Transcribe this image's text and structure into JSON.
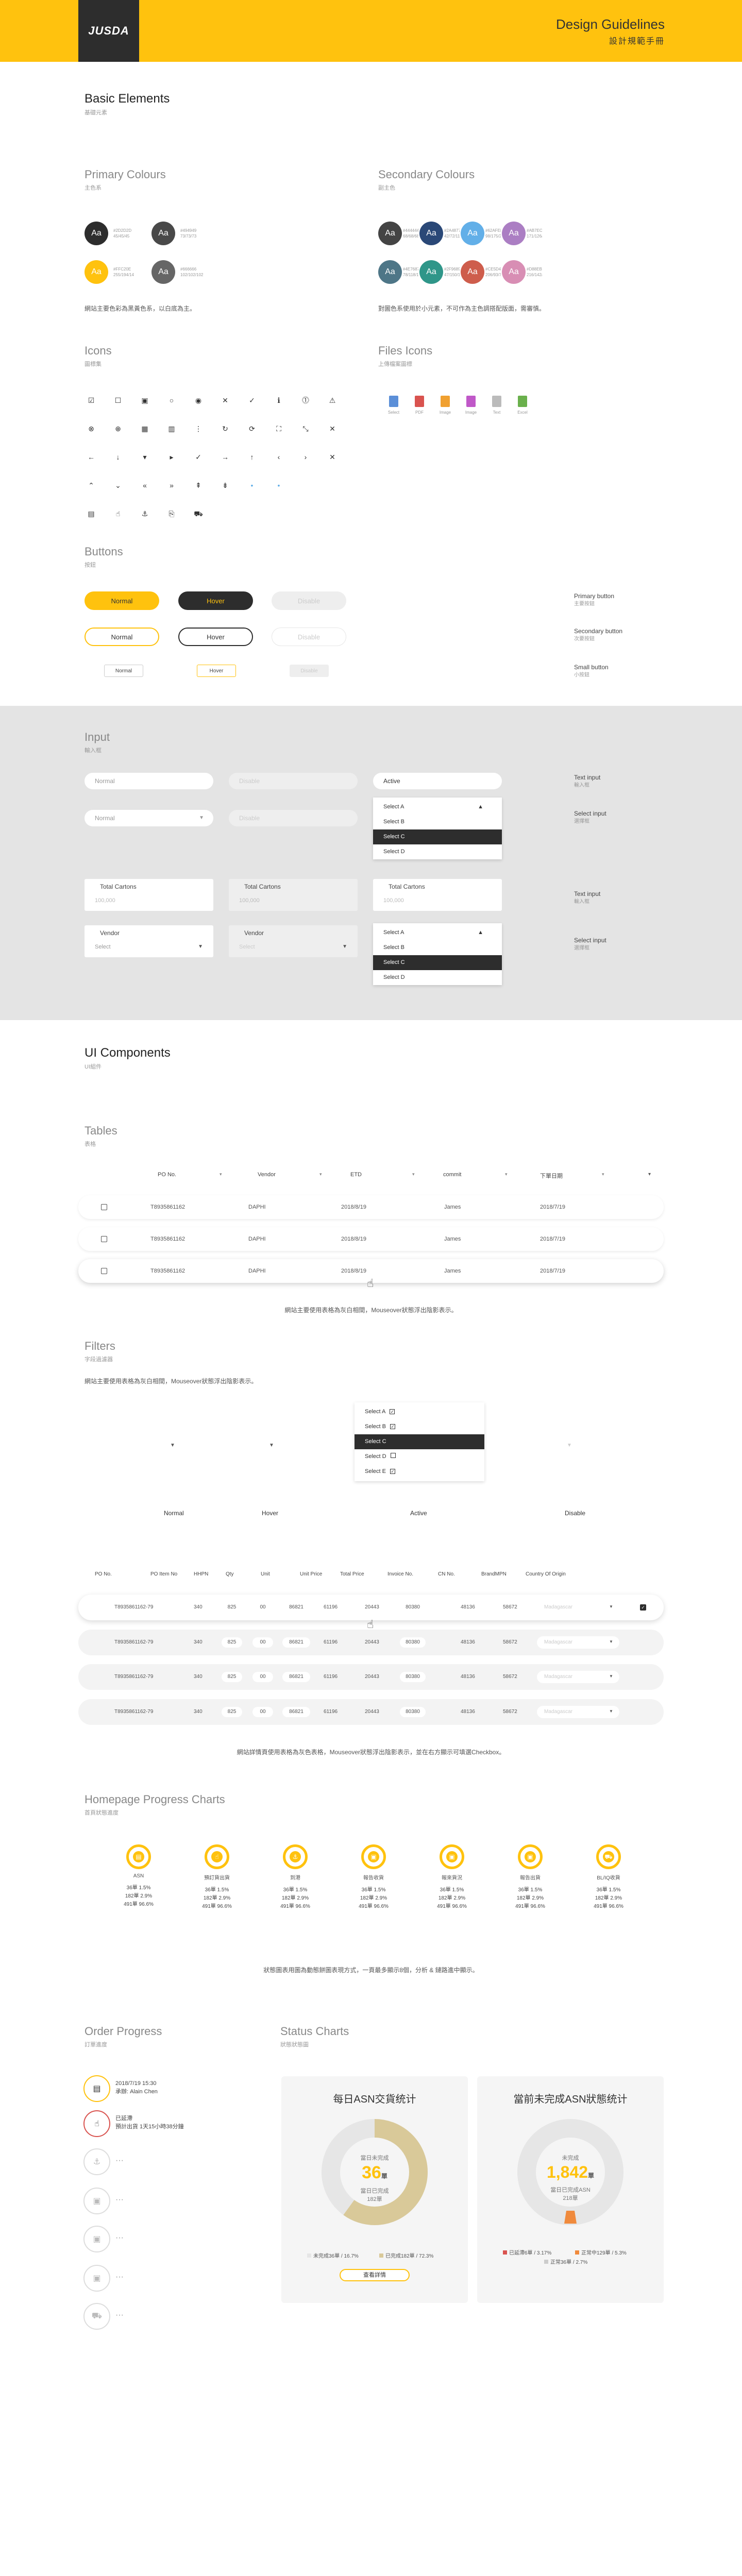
{
  "header": {
    "logo": "JUSDA",
    "title": "Design Guidelines",
    "subtitle": "設計規範手冊"
  },
  "basic": {
    "title": "Basic Elements",
    "sub": "基礎元素"
  },
  "primary": {
    "title": "Primary Colours",
    "sub": "主色系",
    "note": "網站主要色彩為黑黃色系，以白底為主。",
    "swatches": [
      {
        "label": "Aa",
        "color": "#2D2D2D",
        "l1": "#2D2D2D",
        "l2": "45/45/45"
      },
      {
        "label": "Aa",
        "color": "#494949",
        "l1": "#494949",
        "l2": "73/73/73"
      },
      {
        "label": "Aa",
        "color": "#FFC20E",
        "l1": "#FFC20E",
        "l2": "255/194/14"
      },
      {
        "label": "Aa",
        "color": "#666666",
        "l1": "#666666",
        "l2": "102/102/102"
      }
    ]
  },
  "secondary": {
    "title": "Secondary Colours",
    "sub": "副主色",
    "note": "對圖色系使用於小元素，不可作為主色調搭配版面，需審慎。",
    "swatches": [
      {
        "label": "Aa",
        "color": "#444444",
        "l1": "#444444",
        "l2": "68/68/68"
      },
      {
        "label": "Aa",
        "color": "#2A4877",
        "l1": "#2A4877",
        "l2": "42/72/119"
      },
      {
        "label": "Aa",
        "color": "#62AFE8",
        "l1": "#62AFE8",
        "l2": "98/175/232"
      },
      {
        "label": "Aa",
        "color": "#AB7EC3",
        "l1": "#AB7EC3",
        "l2": "171/126/195"
      },
      {
        "label": "Aa",
        "color": "#4E7687",
        "l1": "#4E7687",
        "l2": "78/118/135"
      },
      {
        "label": "Aa",
        "color": "#2F9689",
        "l1": "#2F9689",
        "l2": "47/150/137"
      },
      {
        "label": "Aa",
        "color": "#CE5D4C",
        "l1": "#CE5D4C",
        "l2": "206/93/76"
      },
      {
        "label": "Aa",
        "color": "#D88EB4",
        "l1": "#D88EB4",
        "l2": "216/142/180"
      }
    ]
  },
  "icons": {
    "title": "Icons",
    "sub": "圖標集",
    "rows": [
      [
        "☑",
        "☐",
        "▣",
        "○",
        "◉",
        "✕",
        "✓",
        "ℹ",
        "⓵",
        "⚠"
      ],
      [
        "⊗",
        "⊕",
        "▦",
        "▥",
        "⋮",
        "↻",
        "⟳",
        "⛶",
        "⤡",
        "✕"
      ],
      [
        "←",
        "↓",
        "▾",
        "▸",
        "✓",
        "→",
        "↑",
        "‹",
        "›",
        "✕"
      ],
      [
        "⌃",
        "⌄",
        "«",
        "»",
        "⇞",
        "⇟",
        "•",
        "•"
      ],
      [
        "▤",
        "☝",
        "⚓",
        "⎘",
        "⛟"
      ]
    ]
  },
  "files": {
    "title": "Files Icons",
    "sub": "上傳檔案圖標",
    "items": [
      {
        "label": "Select",
        "color": "#5b8fd8"
      },
      {
        "label": "PDF",
        "color": "#d9534f"
      },
      {
        "label": "Image",
        "color": "#f0a030"
      },
      {
        "label": "Image",
        "color": "#c058c8"
      },
      {
        "label": "Text",
        "color": "#bbbbbb"
      },
      {
        "label": "Excel",
        "color": "#6ab04c"
      }
    ]
  },
  "buttons": {
    "title": "Buttons",
    "sub": "按鈕",
    "normal": "Normal",
    "hover": "Hover",
    "disable": "Disable",
    "labels": [
      {
        "t": "Primary button",
        "s": "主要按鈕"
      },
      {
        "t": "Secondary button",
        "s": "次要按鈕"
      },
      {
        "t": "Small button",
        "s": "小按鈕"
      }
    ]
  },
  "input": {
    "title": "Input",
    "sub": "輸入框",
    "normal": "Normal",
    "disable": "Disable",
    "active": "Active",
    "options": [
      "Select A",
      "Select B",
      "Select C",
      "Select D"
    ],
    "box_label": "Total Cartons",
    "box_value": "100,000",
    "vendor_label": "Vendor",
    "vendor_value": "Select",
    "labels": [
      {
        "t": "Text input",
        "s": "輸入框"
      },
      {
        "t": "Select input",
        "s": "選擇框"
      },
      {
        "t": "Text input",
        "s": "輸入框"
      },
      {
        "t": "Select input",
        "s": "選擇框"
      }
    ]
  },
  "ui": {
    "title": "UI Components",
    "sub": "UI組件"
  },
  "tables": {
    "title": "Tables",
    "sub": "表格",
    "headers": [
      "PO No.",
      "Vendor",
      "ETD",
      "commit",
      "下單日期"
    ],
    "row": {
      "po": "T8935861162",
      "vendor": "DAPHI",
      "etd": "2018/8/19",
      "who": "James",
      "date": "2018/7/19"
    },
    "note": "網站主要使用表格為灰白相間，Mouseover狀態浮出陰影表示。"
  },
  "filters": {
    "title": "Filters",
    "sub": "字段過濾器",
    "note": "網站主要使用表格為灰白相間，Mouseover狀態浮出陰影表示。",
    "options": [
      "Select A",
      "Select B",
      "Select C",
      "Select D",
      "Select E"
    ],
    "states": [
      "Normal",
      "Hover",
      "Active",
      "Disable"
    ]
  },
  "table2": {
    "headers": [
      "PO No.",
      "PO Item No",
      "HHPN",
      "Qty",
      "Unit",
      "Unit Price",
      "Total Price",
      "Invoice No.",
      "CN No.",
      "BrandMPN",
      "Country Of Origin"
    ],
    "row": {
      "po": "T8935861162-79",
      "item": "340",
      "hhpn": "825",
      "qty": "00",
      "unit": "86821",
      "up": "61196",
      "tp": "20443",
      "inv": "80380",
      "cn": "48136",
      "brand": "58672",
      "origin": "Madagascar"
    },
    "note": "網站詳情頁使用表格為灰色表格，Mouseover狀態浮出陰影表示，並在右方顯示可填選Checkbox。"
  },
  "progress": {
    "title": "Homepage Progress Charts",
    "sub": "首頁狀態進度",
    "note": "狀態圖表用圖為動態餅圖表現方式，一頁最多顯示8個，分析 & 鏈路進中顯示。",
    "items": [
      {
        "name": "ASN",
        "s1": "36單 1.5%",
        "s2": "182單 2.9%",
        "s3": "491單 96.6%"
      },
      {
        "name": "預訂貨出貨",
        "s1": "36單 1.5%",
        "s2": "182單 2.9%",
        "s3": "491單 96.6%"
      },
      {
        "name": "到港",
        "s1": "36單 1.5%",
        "s2": "182單 2.9%",
        "s3": "491單 96.6%"
      },
      {
        "name": "報告收貨",
        "s1": "36單 1.5%",
        "s2": "182單 2.9%",
        "s3": "491單 96.6%"
      },
      {
        "name": "報來貨況",
        "s1": "36單 1.5%",
        "s2": "182單 2.9%",
        "s3": "491單 96.6%"
      },
      {
        "name": "報告出貨",
        "s1": "36單 1.5%",
        "s2": "182單 2.9%",
        "s3": "491單 96.6%"
      },
      {
        "name": "BL/IQ收貨",
        "s1": "36單 1.5%",
        "s2": "182單 2.9%",
        "s3": "491單 96.6%"
      }
    ]
  },
  "order": {
    "title": "Order Progress",
    "sub": "訂單進度",
    "steps": [
      {
        "l1": "2018/7/19 15:30",
        "l2": "承辦: Alain Chen"
      },
      {
        "l1": "已延滯",
        "l2": "預計出貨 1天15小時38分鐘"
      }
    ],
    "more": "···"
  },
  "status": {
    "title": "Status Charts",
    "sub": "狀態狀態圖",
    "card1": {
      "title": "每日ASN交貨统计",
      "center_label": "當日未完成",
      "center_value": "36",
      "center_unit": "單",
      "sub_label": "當日已完成",
      "sub_value": "182單",
      "legend1": "未完成36單 / 16.7%",
      "legend2": "已完成182單 / 72.3%",
      "button": "查看詳情"
    },
    "card2": {
      "title": "當前未完成ASN狀態统计",
      "center_label": "未完成",
      "center_value": "1,842",
      "center_unit": "單",
      "sub_label": "當日已完成ASN",
      "sub_value": "218單",
      "legend1": "已延滯6單 / 3.17%",
      "legend2": "正常中129單 / 5.3%",
      "legend3": "正常36單 / 2.7%"
    }
  }
}
